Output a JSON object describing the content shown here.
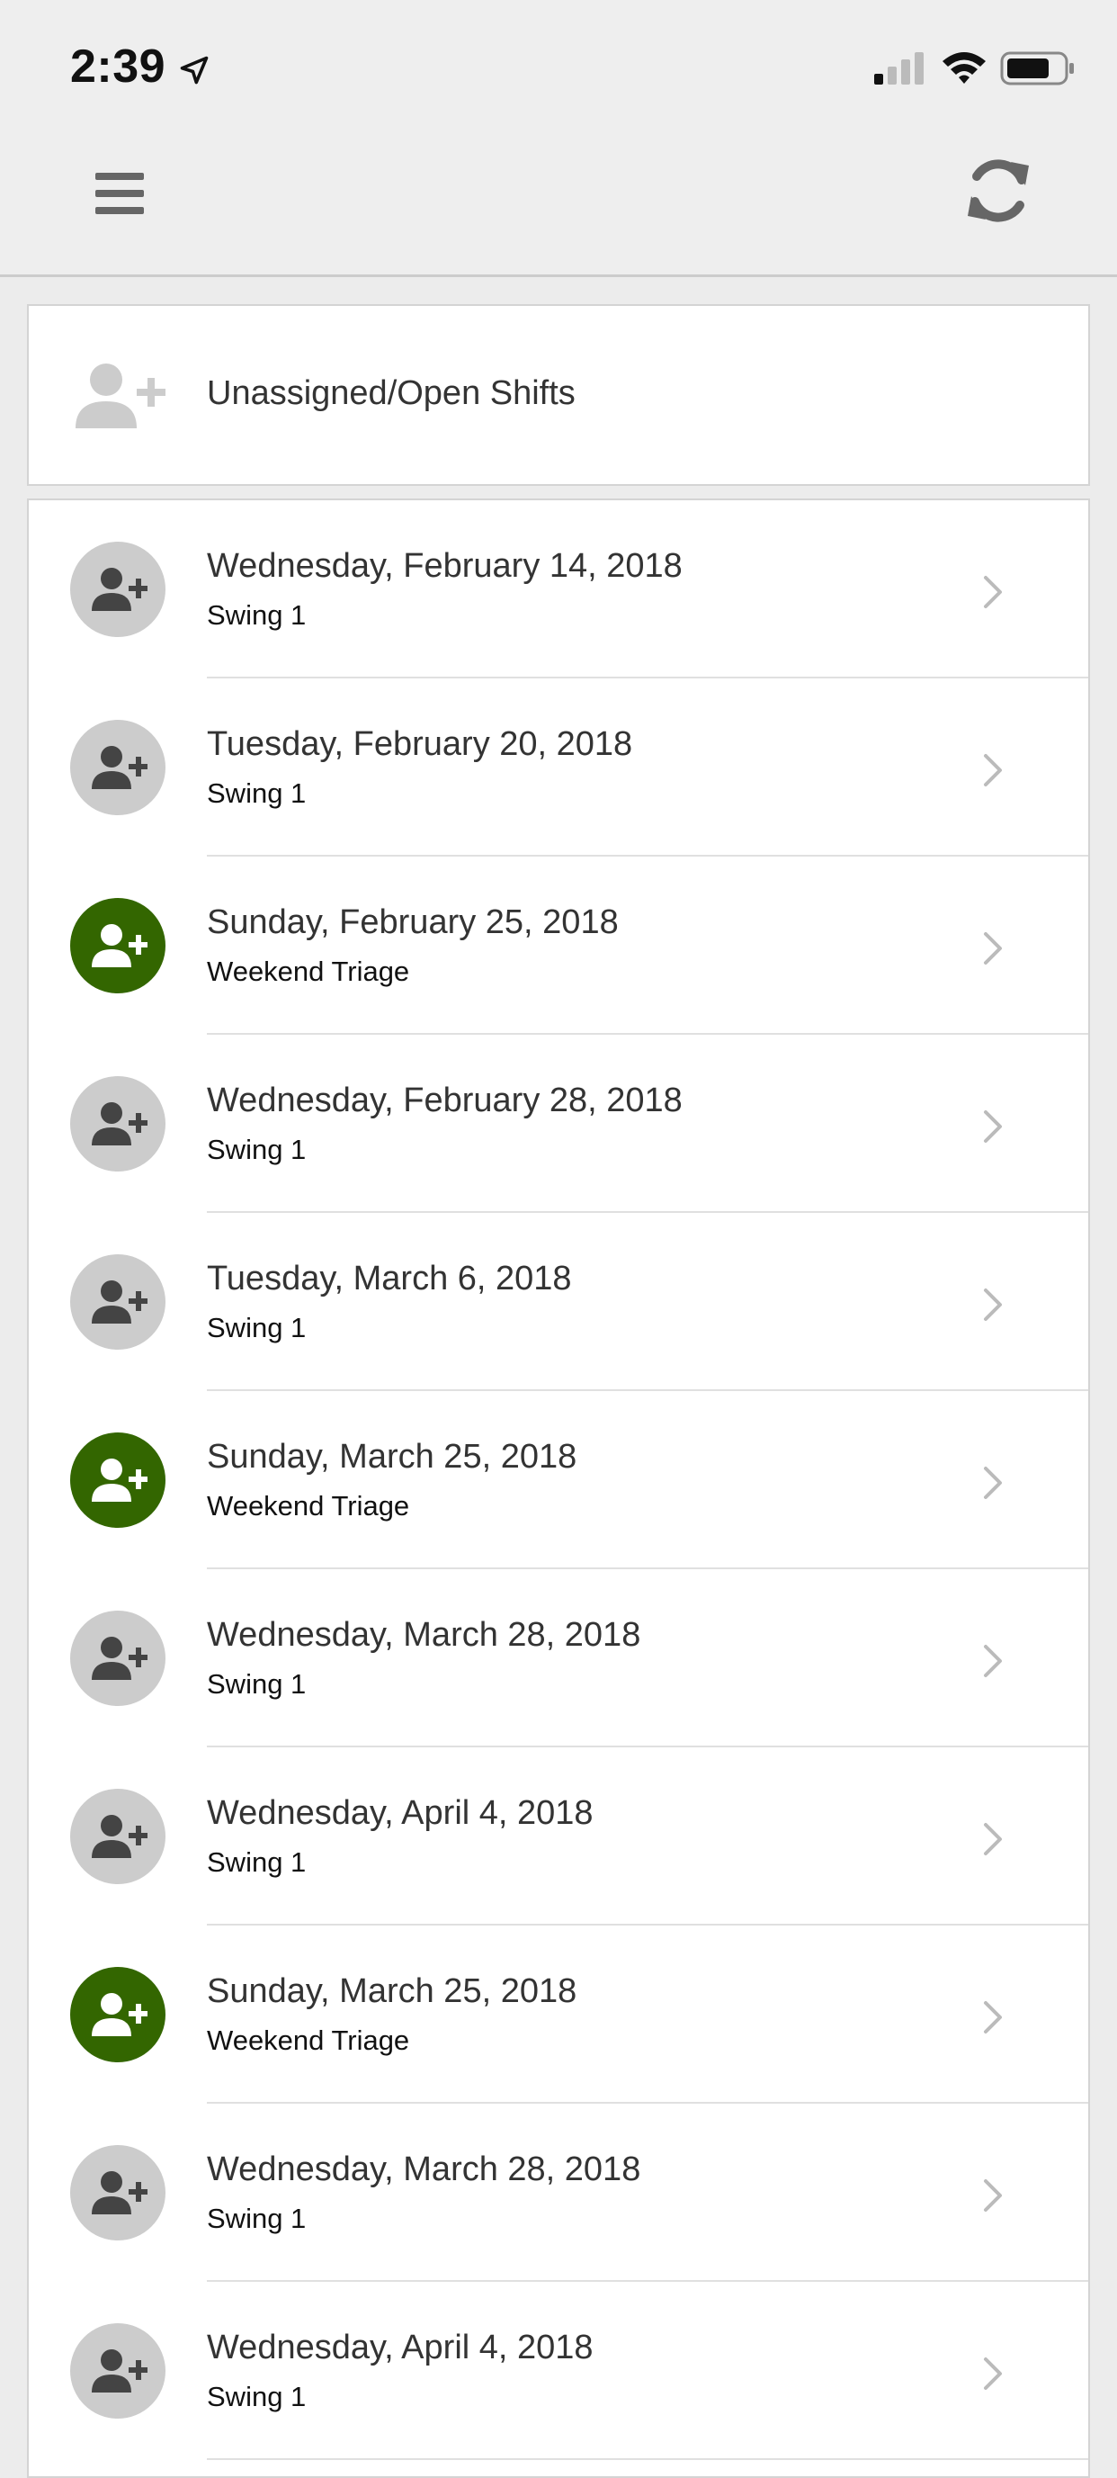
{
  "status_bar": {
    "time": "2:39",
    "location_icon": "location-arrow-icon",
    "signal_icon": "cellular-signal-icon",
    "wifi_icon": "wifi-icon",
    "battery_icon": "battery-icon"
  },
  "header": {
    "menu_icon": "hamburger-menu-icon",
    "refresh_icon": "refresh-icon"
  },
  "unassigned": {
    "label": "Unassigned/Open Shifts",
    "icon": "add-user-icon"
  },
  "colors": {
    "assigned_avatar": "#336600",
    "unassigned_avatar": "#cccccc",
    "icon_dark": "#444444",
    "background": "#ececec"
  },
  "shifts": [
    {
      "date": "Wednesday, February 14, 2018",
      "name": "Swing 1",
      "assigned": false
    },
    {
      "date": "Tuesday, February 20, 2018",
      "name": "Swing 1",
      "assigned": false
    },
    {
      "date": "Sunday, February 25, 2018",
      "name": "Weekend Triage",
      "assigned": true
    },
    {
      "date": "Wednesday, February 28, 2018",
      "name": "Swing 1",
      "assigned": false
    },
    {
      "date": "Tuesday, March 6, 2018",
      "name": "Swing 1",
      "assigned": false
    },
    {
      "date": "Sunday, March 25, 2018",
      "name": "Weekend Triage",
      "assigned": true
    },
    {
      "date": "Wednesday, March 28, 2018",
      "name": "Swing 1",
      "assigned": false
    },
    {
      "date": "Wednesday, April 4, 2018",
      "name": "Swing 1",
      "assigned": false
    },
    {
      "date": "Sunday, March 25, 2018",
      "name": "Weekend Triage",
      "assigned": true
    },
    {
      "date": "Wednesday, March 28, 2018",
      "name": "Swing 1",
      "assigned": false
    },
    {
      "date": "Wednesday, April 4, 2018",
      "name": "Swing 1",
      "assigned": false
    }
  ]
}
